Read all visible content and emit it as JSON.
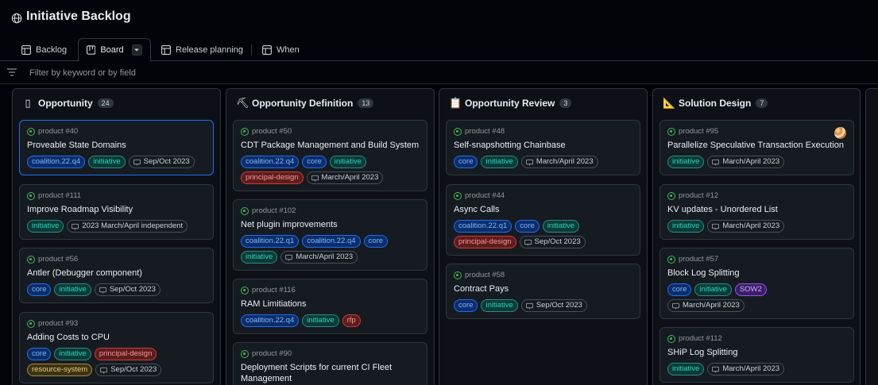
{
  "header": {
    "title": "Initiative Backlog",
    "icon": "globe-icon"
  },
  "tabs": [
    {
      "label": "Backlog",
      "icon": "table-icon",
      "active": false
    },
    {
      "label": "Board",
      "icon": "board-icon",
      "active": true
    },
    {
      "label": "Release planning",
      "icon": "table-icon",
      "active": false
    },
    {
      "label": "When",
      "icon": "table-icon",
      "active": false
    }
  ],
  "filter": {
    "placeholder": "Filter by keyword or by field"
  },
  "colors": {
    "accent": "#1f6feb",
    "open": "#3fb950"
  },
  "columns": [
    {
      "name": "Opportunity",
      "icon": "▯",
      "count": "24",
      "cards": [
        {
          "ref": "product #40",
          "title": "Proveable State Domains",
          "selected": true,
          "labels": [
            [
              "coalition.22.q4",
              "coal"
            ],
            [
              "initiative",
              "init"
            ]
          ],
          "date": "Sep/Oct 2023"
        },
        {
          "ref": "product #111",
          "title": "Improve Roadmap Visibility",
          "labels": [
            [
              "initiative",
              "init"
            ]
          ],
          "date": "2023 March/April independent"
        },
        {
          "ref": "product #56",
          "title": "Antler (Debugger component)",
          "labels": [
            [
              "core",
              "core"
            ],
            [
              "initiative",
              "init"
            ]
          ],
          "date": "Sep/Oct 2023"
        },
        {
          "ref": "product #93",
          "title": "Adding Costs to CPU",
          "labels": [
            [
              "core",
              "core"
            ],
            [
              "initiative",
              "init"
            ],
            [
              "principal-design",
              "pd"
            ],
            [
              "resource-system",
              "rs"
            ]
          ],
          "date": "Sep/Oct 2023"
        }
      ]
    },
    {
      "name": "Opportunity Definition",
      "icon": "⛏",
      "count": "13",
      "cards": [
        {
          "ref": "product #50",
          "title": "CDT Package Management and Build System",
          "labels": [
            [
              "coalition.22.q4",
              "coal"
            ],
            [
              "core",
              "core"
            ],
            [
              "initiative",
              "init"
            ],
            [
              "principal-design",
              "pd"
            ]
          ],
          "date": "March/April 2023"
        },
        {
          "ref": "product #102",
          "title": "Net plugin improvements",
          "labels": [
            [
              "coalition.22.q1",
              "coal"
            ],
            [
              "coalition.22.q4",
              "coal"
            ],
            [
              "core",
              "core"
            ],
            [
              "initiative",
              "init"
            ]
          ],
          "date": "March/April 2023"
        },
        {
          "ref": "product #116",
          "title": "RAM Limitiations",
          "labels": [
            [
              "coalition.22.q4",
              "coal"
            ],
            [
              "initiative",
              "init"
            ],
            [
              "rfp",
              "rfp"
            ]
          ],
          "date": ""
        },
        {
          "ref": "product #90",
          "title": "Deployment Scripts for current CI Fleet Management",
          "labels": [],
          "date": ""
        }
      ]
    },
    {
      "name": "Opportunity Review",
      "icon": "📋",
      "count": "3",
      "cards": [
        {
          "ref": "product #48",
          "title": "Self-snapshotting Chainbase",
          "labels": [
            [
              "core",
              "core"
            ],
            [
              "initiative",
              "init"
            ]
          ],
          "date": "March/April 2023"
        },
        {
          "ref": "product #44",
          "title": "Async Calls",
          "labels": [
            [
              "coalition.22.q1",
              "coal"
            ],
            [
              "core",
              "core"
            ],
            [
              "initiative",
              "init"
            ],
            [
              "principal-design",
              "pd"
            ]
          ],
          "date": "Sep/Oct 2023"
        },
        {
          "ref": "product #58",
          "title": "Contract Pays",
          "labels": [
            [
              "core",
              "core"
            ],
            [
              "initiative",
              "init"
            ]
          ],
          "date": "Sep/Oct 2023"
        }
      ]
    },
    {
      "name": "Solution Design",
      "icon": "📐",
      "count": "7",
      "cards": [
        {
          "ref": "product #95",
          "title": "Parallelize Speculative Transaction Execution",
          "avatar": true,
          "labels": [
            [
              "initiative",
              "init"
            ]
          ],
          "date": "March/April 2023"
        },
        {
          "ref": "product #12",
          "title": "KV updates - Unordered List",
          "labels": [
            [
              "initiative",
              "init"
            ]
          ],
          "date": "March/April 2023"
        },
        {
          "ref": "product #57",
          "title": "Block Log Splitting",
          "labels": [
            [
              "core",
              "core"
            ],
            [
              "initiative",
              "init"
            ],
            [
              "SOW2",
              "sow"
            ]
          ],
          "date": "March/April 2023"
        },
        {
          "ref": "product #112",
          "title": "SHiP Log Splitting",
          "labels": [
            [
              "initiative",
              "init"
            ]
          ],
          "date": "March/April 2023"
        }
      ]
    }
  ]
}
